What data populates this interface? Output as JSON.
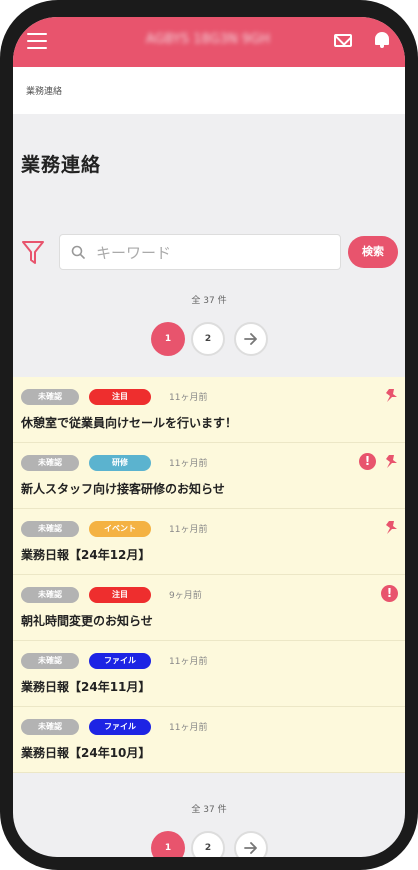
{
  "header": {
    "title": "AGBYS 18G3N 9GH",
    "menu_icon": "hamburger-menu-icon",
    "mail_icon": "mail-icon",
    "bell_icon": "bell-icon"
  },
  "breadcrumb": "業務連絡",
  "page_title": "業務連絡",
  "search": {
    "placeholder": "キーワード",
    "button_label": "検索",
    "filter_icon": "filter-icon"
  },
  "count_label": "全 37 件",
  "pagination": {
    "current": "1",
    "next_page": "2"
  },
  "colors": {
    "accent": "#e8546d",
    "unread_bg": "#fdf9dc",
    "tag_red": "#ee2e2e",
    "tag_teal": "#5bb3cf",
    "tag_orange": "#f4b243",
    "tag_blue": "#1d24e4",
    "status_gray": "#b3b3b3"
  },
  "items": [
    {
      "status": "未確認",
      "category": "注目",
      "category_color": "#ee2e2e",
      "time": "11ヶ月前",
      "title": "休憩室で従業員向けセールを行います！",
      "pinned": true,
      "alert": false
    },
    {
      "status": "未確認",
      "category": "研修",
      "category_color": "#5bb3cf",
      "time": "11ヶ月前",
      "title": "新人スタッフ向け接客研修のお知らせ",
      "pinned": true,
      "alert": true
    },
    {
      "status": "未確認",
      "category": "イベント",
      "category_color": "#f4b243",
      "time": "11ヶ月前",
      "title": "業務日報【24年12月】",
      "pinned": true,
      "alert": false
    },
    {
      "status": "未確認",
      "category": "注目",
      "category_color": "#ee2e2e",
      "time": "9ヶ月前",
      "title": "朝礼時間変更のお知らせ",
      "pinned": false,
      "alert": true
    },
    {
      "status": "未確認",
      "category": "ファイル",
      "category_color": "#1d24e4",
      "time": "11ヶ月前",
      "title": "業務日報【24年11月】",
      "pinned": false,
      "alert": false
    },
    {
      "status": "未確認",
      "category": "ファイル",
      "category_color": "#1d24e4",
      "time": "11ヶ月前",
      "title": "業務日報【24年10月】",
      "pinned": false,
      "alert": false
    }
  ]
}
